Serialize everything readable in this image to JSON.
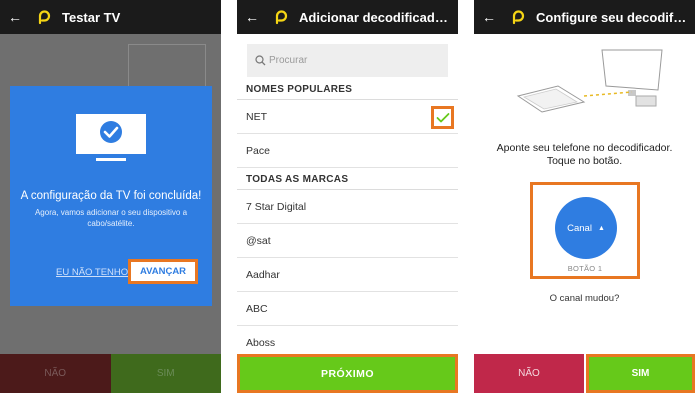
{
  "colors": {
    "topbar": "#1b1b1b",
    "brand_logo": "#f5d515",
    "dialog_blue": "#2f7de1",
    "highlight_orange": "#e87722",
    "green": "#66c91a",
    "red": "#c0284a"
  },
  "screen1": {
    "title": "Testar TV",
    "dialog": {
      "icon": "tv-check-icon",
      "title": "A configuração da TV foi concluída!",
      "subtitle": "Agora, vamos adicionar o seu dispositivo a cabo/satélite.",
      "secondary_link": "EU NÃO TENHO",
      "primary_button": "AVANÇAR"
    },
    "bottom": {
      "no": "NÃO",
      "yes": "SIM"
    }
  },
  "screen2": {
    "title": "Adicionar decodificador de cabo/satélite",
    "search": {
      "placeholder": "Procurar",
      "icon": "search-icon"
    },
    "popular_header": "NOMES POPULARES",
    "popular": [
      {
        "label": "NET",
        "selected": true
      },
      {
        "label": "Pace",
        "selected": false
      }
    ],
    "all_header": "TODAS AS MARCAS",
    "brands": [
      "7 Star Digital",
      "@sat",
      "Aadhar",
      "ABC",
      "Aboss"
    ],
    "next_button": "PRÓXIMO"
  },
  "screen3": {
    "title": "Configure seu decodificador",
    "instruction_line1": "Aponte seu telefone no decodificador.",
    "instruction_line2": "Toque no botão.",
    "channel_button": "Canal",
    "button_caption": "BOTÃO 1",
    "question": "O canal mudou?",
    "no": "NÃO",
    "yes": "SIM"
  }
}
